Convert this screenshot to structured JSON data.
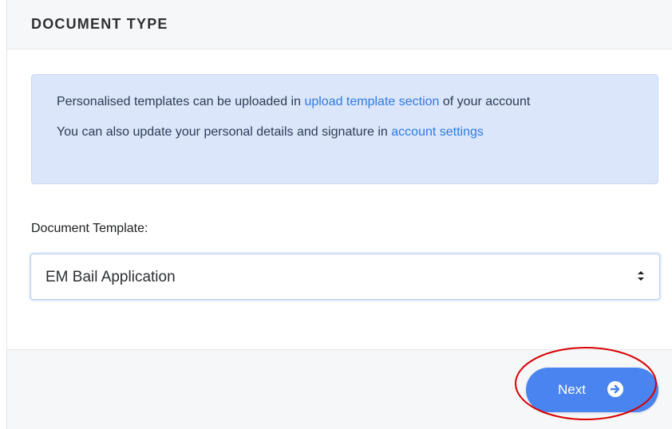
{
  "card": {
    "title": "DOCUMENT TYPE"
  },
  "info": {
    "line1_prefix": "Personalised templates can be uploaded in ",
    "line1_link": "upload template section",
    "line1_suffix": " of your account",
    "line2_prefix": "You can also update your personal details and signature in ",
    "line2_link": "account settings"
  },
  "form": {
    "template_label": "Document Template:",
    "template_selected": "EM Bail Application"
  },
  "footer": {
    "next_label": "Next"
  },
  "icons": {
    "select": "select-arrows-icon",
    "next": "arrow-right-circle-icon"
  },
  "colors": {
    "primary": "#4a84f0",
    "link": "#2f7ae5",
    "info_background": "#dbe6fb",
    "annotation": "#d90000"
  }
}
